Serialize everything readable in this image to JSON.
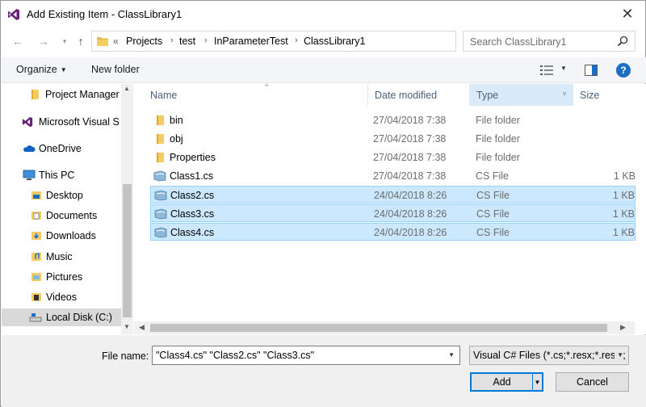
{
  "window": {
    "title": "Add Existing Item - ClassLibrary1"
  },
  "address": {
    "overflow": "«",
    "crumbs": [
      "Projects",
      "test",
      "InParameterTest",
      "ClassLibrary1"
    ],
    "search_placeholder": "Search ClassLibrary1"
  },
  "toolbar": {
    "organize": "Organize",
    "new_folder": "New folder",
    "help": "?"
  },
  "nav": {
    "items": [
      {
        "label": "Project Manager",
        "icon": "folder-icon"
      },
      {
        "label": "Microsoft Visual S",
        "icon": "visual-studio-icon"
      },
      {
        "label": "OneDrive",
        "icon": "onedrive-icon"
      },
      {
        "label": "This PC",
        "icon": "pc-icon"
      },
      {
        "label": "Desktop",
        "icon": "desktop-folder-icon"
      },
      {
        "label": "Documents",
        "icon": "documents-folder-icon"
      },
      {
        "label": "Downloads",
        "icon": "downloads-folder-icon"
      },
      {
        "label": "Music",
        "icon": "music-folder-icon"
      },
      {
        "label": "Pictures",
        "icon": "pictures-folder-icon"
      },
      {
        "label": "Videos",
        "icon": "videos-folder-icon"
      },
      {
        "label": "Local Disk (C:)",
        "icon": "disk-icon"
      }
    ]
  },
  "columns": {
    "name": "Name",
    "date": "Date modified",
    "type": "Type",
    "size": "Size"
  },
  "files": [
    {
      "name": "bin",
      "date": "27/04/2018 7:38",
      "type": "File folder",
      "size": "",
      "icon": "folder-icon",
      "selected": false
    },
    {
      "name": "obj",
      "date": "27/04/2018 7:38",
      "type": "File folder",
      "size": "",
      "icon": "folder-icon",
      "selected": false
    },
    {
      "name": "Properties",
      "date": "27/04/2018 7:38",
      "type": "File folder",
      "size": "",
      "icon": "folder-icon",
      "selected": false
    },
    {
      "name": "Class1.cs",
      "date": "27/04/2018 7:38",
      "type": "CS File",
      "size": "1 KB",
      "icon": "cs-file-icon",
      "selected": false
    },
    {
      "name": "Class2.cs",
      "date": "24/04/2018 8:26",
      "type": "CS File",
      "size": "1 KB",
      "icon": "cs-file-icon",
      "selected": true
    },
    {
      "name": "Class3.cs",
      "date": "24/04/2018 8:26",
      "type": "CS File",
      "size": "1 KB",
      "icon": "cs-file-icon",
      "selected": true
    },
    {
      "name": "Class4.cs",
      "date": "24/04/2018 8:26",
      "type": "CS File",
      "size": "1 KB",
      "icon": "cs-file-icon",
      "selected": true
    }
  ],
  "bottom": {
    "file_name_label": "File name:",
    "file_name_value": "\"Class4.cs\" \"Class2.cs\" \"Class3.cs\"",
    "filter_value": "Visual C# Files (*.cs;*.resx;*.resw;",
    "add_label": "Add",
    "cancel_label": "Cancel"
  },
  "colors": {
    "accent": "#0078d7",
    "selection": "#cce8ff",
    "selection_border": "#99d1ff",
    "folder": "#e8b84a"
  }
}
